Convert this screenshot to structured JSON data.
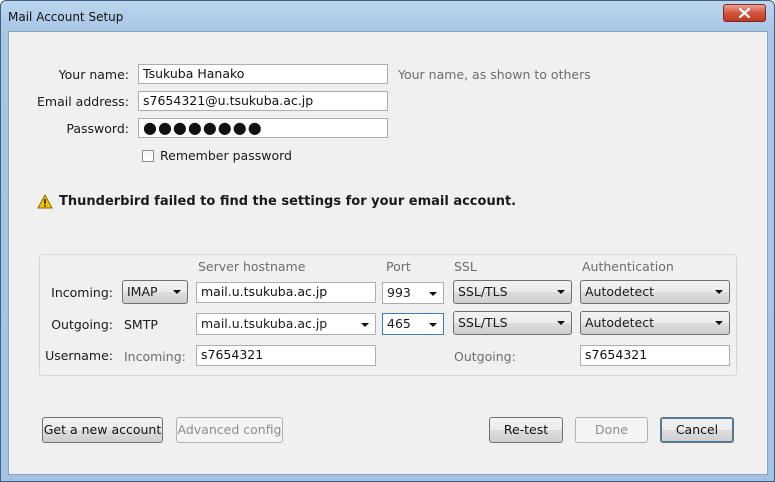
{
  "window": {
    "title": "Mail Account Setup"
  },
  "identity": {
    "name_label": "Your name:",
    "name_value": "Tsukuba Hanako",
    "name_hint": "Your name, as shown to others",
    "email_label": "Email address:",
    "email_value": "s7654321@u.tsukuba.ac.jp",
    "password_label": "Password:",
    "password_value": "●●●●●●●●",
    "remember_label": "Remember password",
    "remember_checked": false
  },
  "warning": {
    "text": "Thunderbird failed to find the settings for your email account."
  },
  "server": {
    "headers": {
      "hostname": "Server hostname",
      "port": "Port",
      "ssl": "SSL",
      "auth": "Authentication"
    },
    "incoming": {
      "label": "Incoming:",
      "protocol": "IMAP",
      "hostname": "mail.u.tsukuba.ac.jp",
      "port": "993",
      "ssl": "SSL/TLS",
      "auth": "Autodetect"
    },
    "outgoing": {
      "label": "Outgoing:",
      "protocol": "SMTP",
      "hostname": "mail.u.tsukuba.ac.jp",
      "port": "465",
      "ssl": "SSL/TLS",
      "auth": "Autodetect"
    },
    "username": {
      "label": "Username:",
      "incoming_label": "Incoming:",
      "incoming_value": "s7654321",
      "outgoing_label": "Outgoing:",
      "outgoing_value": "s7654321"
    }
  },
  "buttons": {
    "new_account": "Get a new account",
    "advanced": "Advanced config",
    "retest": "Re-test",
    "done": "Done",
    "cancel": "Cancel"
  },
  "colors": {
    "warning_icon": "#f5c400",
    "focus_border": "#3c7fb1"
  }
}
